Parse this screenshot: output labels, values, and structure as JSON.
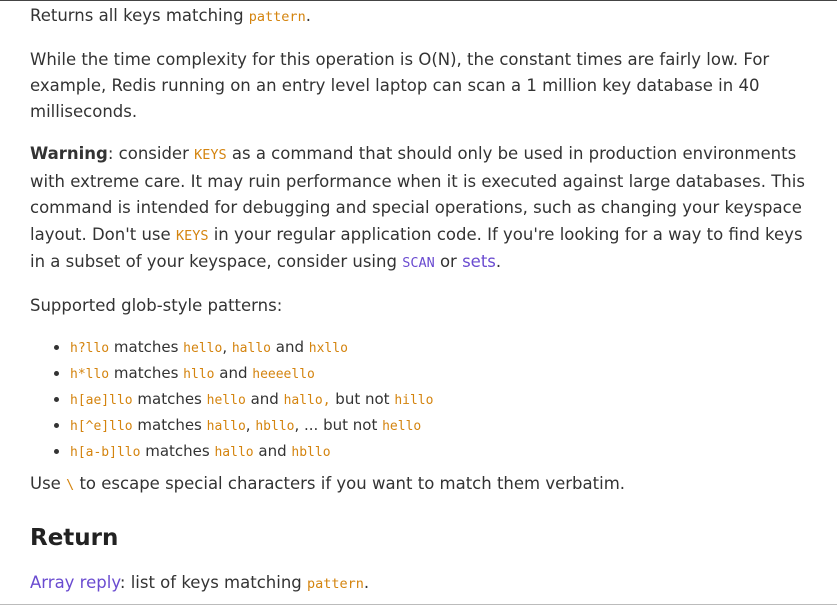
{
  "intro": {
    "text": "Returns all keys matching ",
    "code": "pattern",
    "end": "."
  },
  "complexity": "While the time complexity for this operation is O(N), the constant times are fairly low. For example, Redis running on an entry level laptop can scan a 1 million key database in 40 milliseconds.",
  "warning": {
    "label": "Warning",
    "t1": ": consider ",
    "code1": "KEYS",
    "t2": " as a command that should only be used in production environments with extreme care. It may ruin performance when it is executed against large databases. This command is intended for debugging and special operations, such as changing your keyspace layout. Don't use ",
    "code2": "KEYS",
    "t3": " in your regular application code. If you're looking for a way to find keys in a subset of your keyspace, consider using ",
    "scan_link": "SCAN",
    "t4": " or ",
    "sets_link": "sets",
    "t5": "."
  },
  "patterns_heading": "Supported glob-style patterns:",
  "patterns": [
    {
      "p": "h?llo",
      "t1": " matches ",
      "e1": "hello",
      "s1": ", ",
      "e2": "hallo",
      "s2": " and ",
      "e3": "hxllo"
    },
    {
      "p": "h*llo",
      "t1": " matches ",
      "e1": "hllo",
      "s1": " and ",
      "e2": "heeeello"
    },
    {
      "p": "h[ae]llo",
      "t1": " matches ",
      "e1": "hello",
      "s1": " and ",
      "e2": "hallo,",
      "s2": " but not ",
      "e3": "hillo"
    },
    {
      "p": "h[^e]llo",
      "t1": " matches ",
      "e1": "hallo",
      "s1": ", ",
      "e2": "hbllo",
      "s2": ", ... but not ",
      "e3": "hello"
    },
    {
      "p": "h[a-b]llo",
      "t1": " matches ",
      "e1": "hallo",
      "s1": " and ",
      "e2": "hbllo"
    }
  ],
  "escape": {
    "t1": "Use ",
    "code": "\\",
    "t2": " to escape special characters if you want to match them verbatim."
  },
  "return_heading": "Return",
  "return": {
    "link": "Array reply",
    "t1": ": list of keys matching ",
    "code": "pattern",
    "end": "."
  }
}
